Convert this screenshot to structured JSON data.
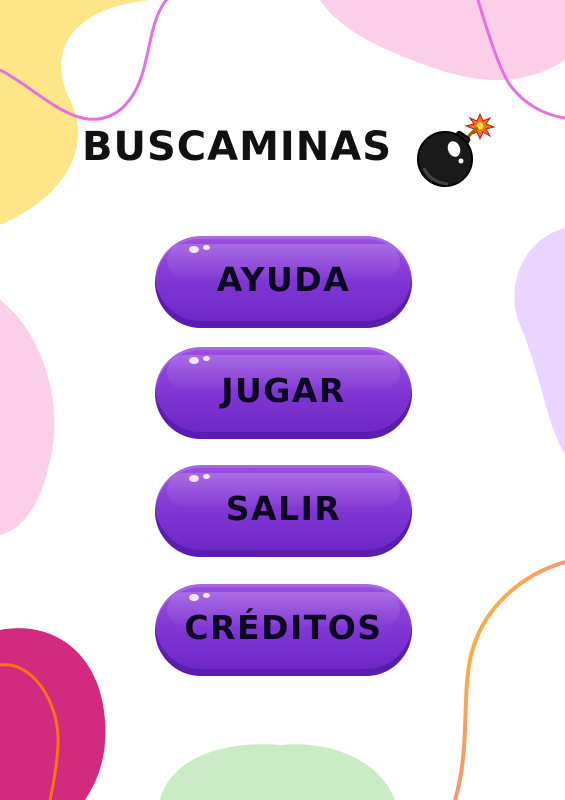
{
  "title": "Buscaminas",
  "title_icon": "bomb-icon",
  "menu": [
    {
      "id": "ayuda",
      "label": "AYUDA"
    },
    {
      "id": "jugar",
      "label": "JUGAR"
    },
    {
      "id": "salir",
      "label": "SALIR"
    },
    {
      "id": "creditos",
      "label": "CRÉDITOS"
    }
  ],
  "colors": {
    "button": "#7e34d2",
    "button_dark": "#5a1db0",
    "blob_yellow": "#fde68a",
    "blob_pink": "#fbcfe8",
    "blob_lilac": "#e9d5ff",
    "blob_magenta": "#d12a7f",
    "blob_green": "#c9ecc4",
    "line_pink": "#ea6ee0",
    "line_orange": "#f97316"
  }
}
